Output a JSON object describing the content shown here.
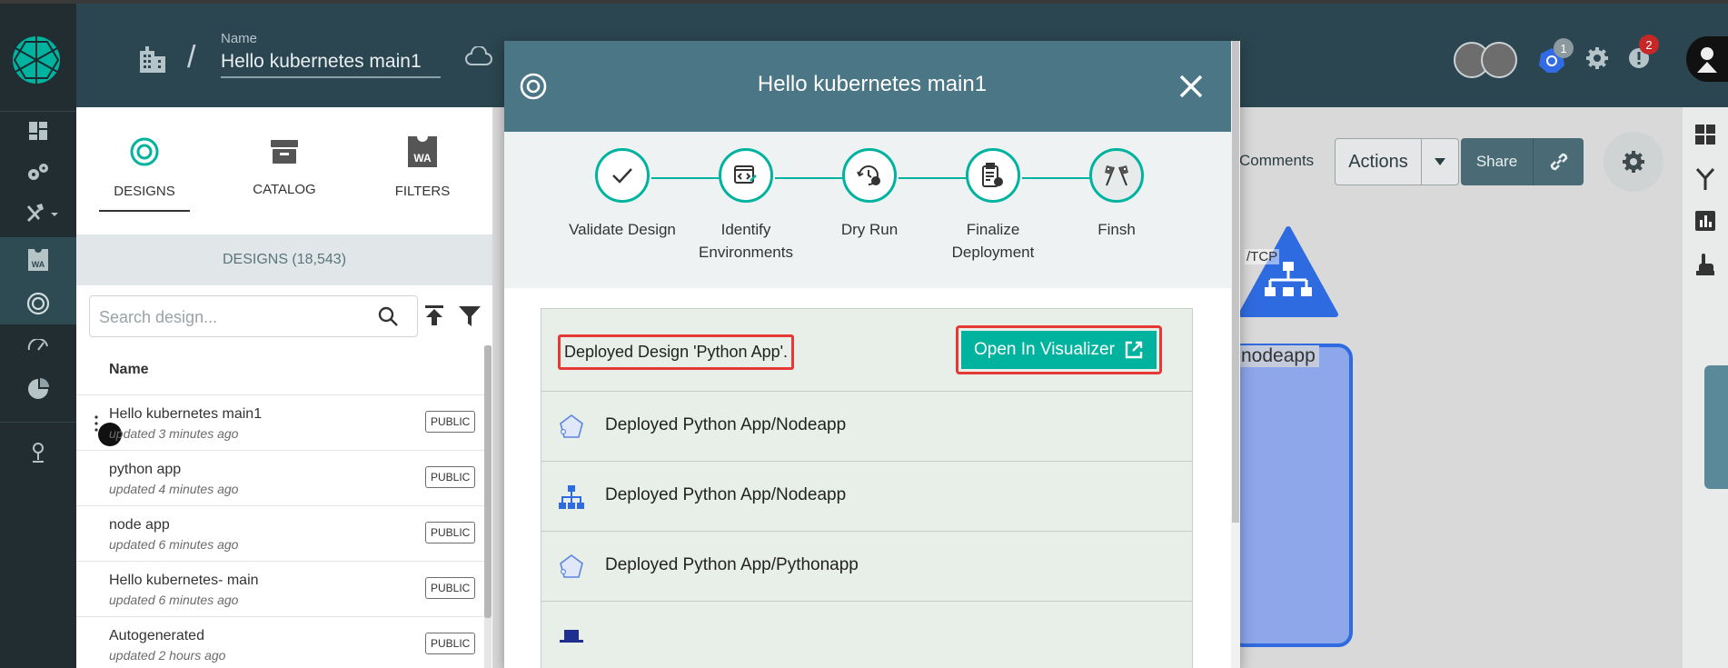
{
  "header": {
    "name_label": "Name",
    "design_name": "Hello kubernetes main1",
    "notifications_count": "1",
    "alerts_count": "2"
  },
  "left_panel": {
    "tabs": [
      {
        "label": "DESIGNS",
        "icon": "meshery-design-icon",
        "active": true
      },
      {
        "label": "CATALOG",
        "icon": "catalog-box-icon",
        "active": false
      },
      {
        "label": "FILTERS",
        "icon": "wasm-filter-icon",
        "active": false
      }
    ],
    "designs_count": "DESIGNS (18,543)",
    "search_placeholder": "Search design...",
    "column_header": "Name",
    "rows": [
      {
        "title": "Hello kubernetes main1",
        "subtitle": "updated 3 minutes ago",
        "badge": "PUBLIC"
      },
      {
        "title": "python app",
        "subtitle": "updated 4 minutes ago",
        "badge": "PUBLIC"
      },
      {
        "title": "node app",
        "subtitle": "updated 6 minutes ago",
        "badge": "PUBLIC"
      },
      {
        "title": "Hello kubernetes- main",
        "subtitle": "updated 6 minutes ago",
        "badge": "PUBLIC"
      },
      {
        "title": "Autogenerated",
        "subtitle": "updated 2 hours ago",
        "badge": "PUBLIC"
      }
    ]
  },
  "toolbar": {
    "comments_label": "Comments",
    "actions_label": "Actions",
    "share_label": "Share"
  },
  "canvas": {
    "node_label": "nodeapp",
    "tcp_label": "/TCP"
  },
  "modal": {
    "title": "Hello kubernetes main1",
    "steps": [
      {
        "label": "Validate Design",
        "icon": "check-icon"
      },
      {
        "label": "Identify Environments",
        "icon": "environment-code-icon"
      },
      {
        "label": "Dry Run",
        "icon": "dry-run-gear-icon"
      },
      {
        "label": "Finalize Deployment",
        "icon": "clipboard-gear-icon"
      },
      {
        "label": "Finsh",
        "icon": "racing-flags-icon"
      }
    ],
    "deployed_message": "Deployed Design 'Python App'.",
    "open_visualizer_label": "Open In Visualizer",
    "log_rows": [
      {
        "text": "Deployed Python App/Nodeapp",
        "icon": "pod-pentagon-icon"
      },
      {
        "text": "Deployed Python App/Nodeapp",
        "icon": "service-tree-icon"
      },
      {
        "text": "Deployed Python App/Pythonapp",
        "icon": "pod-pentagon-icon"
      },
      {
        "text": "",
        "icon": "namespace-block-icon"
      }
    ]
  }
}
